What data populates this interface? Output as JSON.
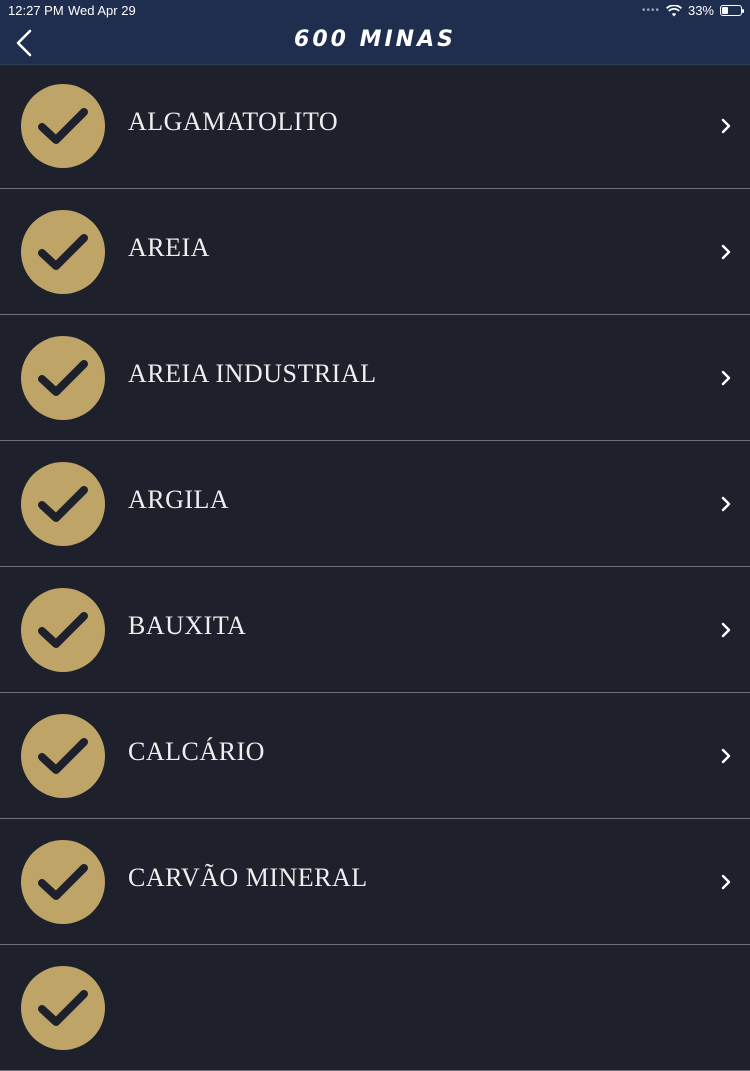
{
  "status_bar": {
    "time": "12:27 PM",
    "date": "Wed Apr 29",
    "battery": "33%",
    "icons": [
      "signal-dots-icon",
      "wifi-icon",
      "battery-icon"
    ]
  },
  "nav": {
    "title": "600 MINAS",
    "back_icon": "chevron-left-icon"
  },
  "colors": {
    "nav_background": "#1f2e4f",
    "list_background": "#1e212b",
    "badge": "#bea467",
    "check": "#1e212b",
    "text": "#eeeeee"
  },
  "list": {
    "items": [
      {
        "label": "ALGAMATOLITO",
        "icon": "checkmark-icon"
      },
      {
        "label": "AREIA",
        "icon": "checkmark-icon"
      },
      {
        "label": "AREIA INDUSTRIAL",
        "icon": "checkmark-icon"
      },
      {
        "label": "ARGILA",
        "icon": "checkmark-icon"
      },
      {
        "label": "BAUXITA",
        "icon": "checkmark-icon"
      },
      {
        "label": "CALCÁRIO",
        "icon": "checkmark-icon"
      },
      {
        "label": "CARVÃO MINERAL",
        "icon": "checkmark-icon"
      },
      {
        "label": "",
        "icon": "checkmark-icon"
      }
    ]
  }
}
